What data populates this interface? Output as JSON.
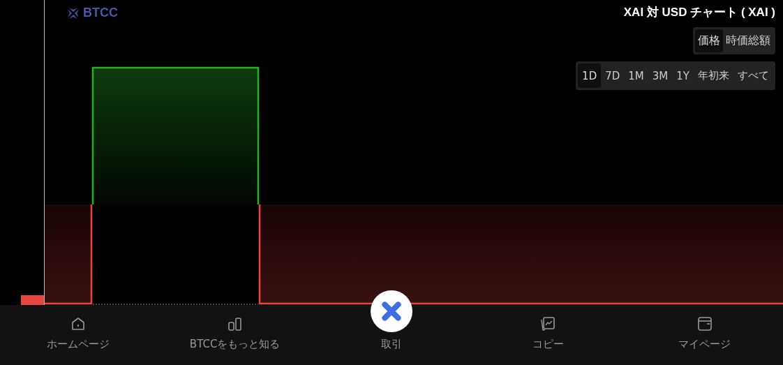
{
  "logo": {
    "text": "BTCC"
  },
  "title": "XAI 対 USD チャート ( XAI )",
  "metric_tabs": [
    {
      "label": "価格",
      "selected": true
    },
    {
      "label": "時価総額",
      "selected": false
    }
  ],
  "range_tabs": [
    {
      "label": "1D",
      "selected": true
    },
    {
      "label": "7D",
      "selected": false
    },
    {
      "label": "1M",
      "selected": false
    },
    {
      "label": "3M",
      "selected": false
    },
    {
      "label": "1Y",
      "selected": false
    },
    {
      "label": "年初来",
      "selected": false
    },
    {
      "label": "すべて",
      "selected": false
    }
  ],
  "nav": [
    {
      "label": "ホームページ",
      "kind": "home"
    },
    {
      "label": "BTCCをもっと知る",
      "kind": "learn"
    },
    {
      "label": "取引",
      "kind": "trade"
    },
    {
      "label": "コピー",
      "kind": "copy"
    },
    {
      "label": "マイページ",
      "kind": "wallet"
    }
  ]
}
